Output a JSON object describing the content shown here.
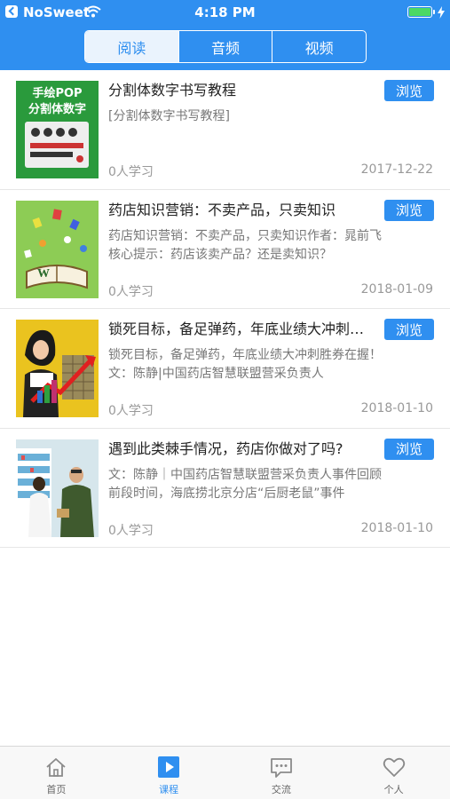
{
  "status_bar": {
    "carrier": "NoSweet",
    "time": "4:18 PM"
  },
  "segments": [
    {
      "label": "阅读",
      "active": true
    },
    {
      "label": "音频",
      "active": false
    },
    {
      "label": "视频",
      "active": false
    }
  ],
  "items": [
    {
      "title": "分割体数字书写教程",
      "desc": "[分割体数字书写教程]",
      "learners": "0人学习",
      "date": "2017-12-22",
      "browse": "浏览",
      "thumb_text_line1": "手绘POP",
      "thumb_text_line2": "分割体数字"
    },
    {
      "title": "药店知识营销：不卖产品，只卖知识",
      "desc": "药店知识营销：不卖产品，只卖知识作者：晁前飞核心提示：药店该卖产品？还是卖知识？",
      "learners": "0人学习",
      "date": "2018-01-09",
      "browse": "浏览"
    },
    {
      "title": "锁死目标，备足弹药，年底业绩大冲刺胜券在握！",
      "desc": "锁死目标，备足弹药，年底业绩大冲刺胜券在握！文：陈静|中国药店智慧联盟营采负责人",
      "learners": "0人学习",
      "date": "2018-01-10",
      "browse": "浏览"
    },
    {
      "title": "遇到此类棘手情况，药店你做对了吗?",
      "desc": "文：陈静｜中国药店智慧联盟营采负责人事件回顾前段时间，海底捞北京分店“后厨老鼠”事件",
      "learners": "0人学习",
      "date": "2018-01-10",
      "browse": "浏览"
    }
  ],
  "tabbar": [
    {
      "label": "首页",
      "icon": "home-icon",
      "active": false
    },
    {
      "label": "课程",
      "icon": "play-icon",
      "active": true
    },
    {
      "label": "交流",
      "icon": "chat-icon",
      "active": false
    },
    {
      "label": "个人",
      "icon": "heart-icon",
      "active": false
    }
  ],
  "colors": {
    "primary": "#2f8ff0",
    "battery": "#4cd964"
  }
}
